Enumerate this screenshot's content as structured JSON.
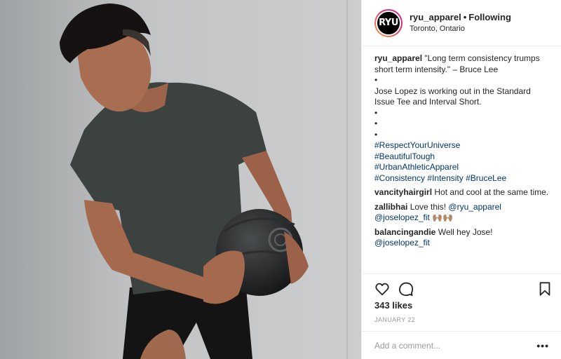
{
  "photo": {
    "description_icon": "post-photo"
  },
  "header": {
    "avatar_text": "RYU",
    "username": "ryu_apparel",
    "separator": "•",
    "follow_status": "Following",
    "location": "Toronto, Ontario"
  },
  "caption": {
    "username": "ryu_apparel",
    "quote": "\"Long term consistency trumps short term intensity.\" – Bruce Lee",
    "bullet": "•",
    "text": "Jose Lopez is working out in the Standard Issue Tee and Interval Short.",
    "hashtags": [
      "#RespectYourUniverse",
      "#BeautifulTough",
      "#UrbanAthleticApparel"
    ],
    "hashtag_row": [
      "#Consistency",
      "#Intensity",
      "#BruceLee"
    ]
  },
  "comments": [
    {
      "username": "vancityhairgirl",
      "text": "Hot and cool at the same time."
    },
    {
      "username": "zallibhai",
      "text": "Love this!",
      "mention1": "@ryu_apparel",
      "mention2": "@joselopez_fit",
      "emoji": "🙌🏽🙌🏽"
    },
    {
      "username": "balancingandie",
      "text": "Well hey Jose!",
      "mention": "@joselopez_fit"
    }
  ],
  "actions": {
    "like_icon": "heart-icon",
    "comment_icon": "comment-icon",
    "save_icon": "bookmark-icon"
  },
  "likes": "343 likes",
  "date": "JANUARY 22",
  "add_comment": {
    "placeholder": "Add a comment...",
    "more": "•••"
  }
}
